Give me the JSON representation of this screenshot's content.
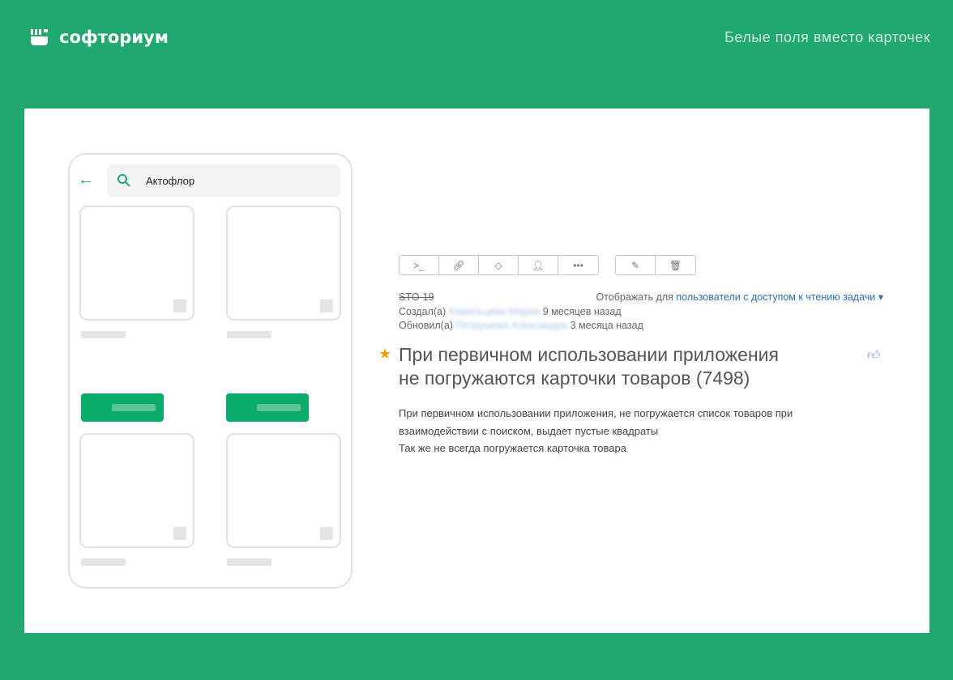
{
  "brand": {
    "name": "софториум",
    "tagline": "Белые поля вместо карточек",
    "accent": "#21a86f"
  },
  "phone": {
    "search_value": "Актофлор",
    "icons": [
      "back-arrow-icon",
      "search-icon"
    ]
  },
  "task": {
    "toolbar": [
      "terminal-icon",
      "link-icon",
      "tag-icon",
      "user-icon",
      "more-icon",
      "edit-icon",
      "delete-icon"
    ],
    "id": "STO-19",
    "visibility_label": "Отображать для",
    "visibility_value": "пользователи с доступом к чтению задачи",
    "created_label": "Создал(а)",
    "created_by": "Комальцева Мария",
    "created_ago": "9 месяцев назад",
    "updated_label": "Обновил(а)",
    "updated_by": "Петрушева Александра",
    "updated_ago": "3 месяца назад",
    "title_line1": "При первичном использовании приложения",
    "title_line2": "не погружаются карточки товаров (7498)",
    "desc": [
      "При первичном использовании приложения, не погружается список товаров при",
      "взаимодействии с поиском, выдает пустые квадраты",
      "Так же не всегда погружается карточка товара"
    ]
  }
}
